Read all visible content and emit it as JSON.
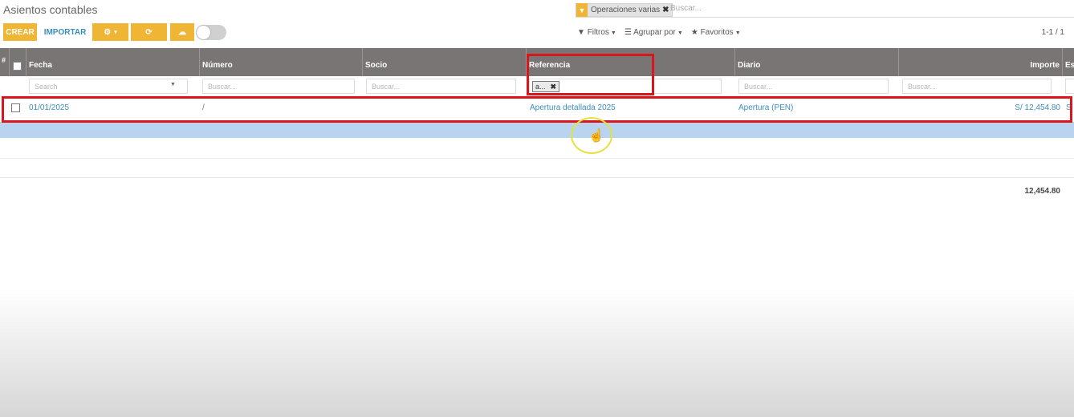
{
  "header": {
    "title": "Asientos contables"
  },
  "search": {
    "facet_label": "Operaciones varias",
    "placeholder": "Buscar..."
  },
  "toolbar": {
    "create_label": "CREAR",
    "import_label": "IMPORTAR",
    "filters_label": "Filtros",
    "group_by_label": "Agrupar por",
    "favorites_label": "Favoritos",
    "pager": "1-1 / 1"
  },
  "table": {
    "hash": "#",
    "columns": [
      "Fecha",
      "Número",
      "Socio",
      "Referencia",
      "Diario",
      "Importe",
      "Es"
    ],
    "filters": {
      "fecha_placeholder": "Search",
      "placeholder": "Buscar...",
      "referencia_tag": "a..."
    },
    "rows": [
      {
        "fecha": "01/01/2025",
        "numero": "/",
        "referencia": "Apertura detallada 2025",
        "diario": "Apertura (PEN)",
        "importe": "S/ 12,454.80",
        "estado": "S"
      }
    ],
    "total": "12,454.80"
  },
  "colors": {
    "accent": "#f0b534",
    "header_bg": "#7a7575",
    "link": "#3c8dbc",
    "annotation": "#d9161b",
    "selected_row": "#b8d4ef"
  },
  "icons": [
    "filter-icon",
    "close-icon",
    "gear-icon",
    "refresh-icon",
    "cloud-upload-icon",
    "hamburger-icon",
    "star-icon",
    "caret-down-icon",
    "hand-cursor-icon"
  ]
}
